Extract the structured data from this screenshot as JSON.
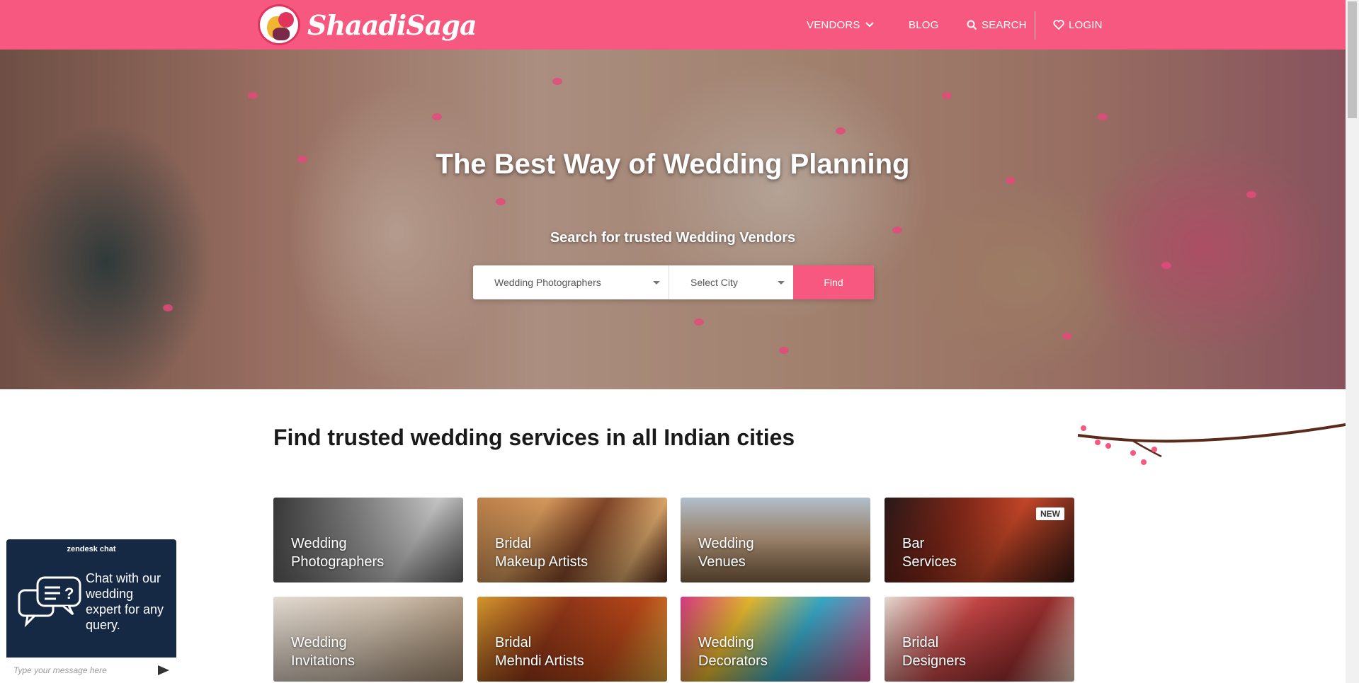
{
  "header": {
    "brand": "ShaadiSaga",
    "nav": {
      "vendors": "VENDORS",
      "blog": "BLOG",
      "search": "SEARCH",
      "login": "LOGIN"
    }
  },
  "hero": {
    "title": "The Best Way of Wedding Planning",
    "subtitle": "Search for trusted Wedding Vendors",
    "category_value": "Wedding Photographers",
    "city_value": "Select City",
    "find_label": "Find"
  },
  "section": {
    "title": "Find trusted wedding services in all Indian cities"
  },
  "cards": [
    {
      "line1": "Wedding",
      "line2": "Photographers"
    },
    {
      "line1": "Bridal",
      "line2": "Makeup Artists"
    },
    {
      "line1": "Wedding",
      "line2": "Venues"
    },
    {
      "line1": "Bar",
      "line2": "Services",
      "badge": "NEW"
    },
    {
      "line1": "Wedding",
      "line2": "Invitations"
    },
    {
      "line1": "Bridal",
      "line2": "Mehndi Artists"
    },
    {
      "line1": "Wedding",
      "line2": "Decorators"
    },
    {
      "line1": "Bridal",
      "line2": "Designers"
    }
  ],
  "chat": {
    "header": "zendesk chat",
    "message": "Chat with our wedding expert for any query.",
    "input_placeholder": "Type your message here"
  },
  "colors": {
    "brand_pink": "#f7587f",
    "chat_navy": "#152844"
  },
  "icons": [
    "logo-icon",
    "chevron-down-icon",
    "search-icon",
    "heart-icon",
    "chat-bubble-icon",
    "send-icon"
  ]
}
